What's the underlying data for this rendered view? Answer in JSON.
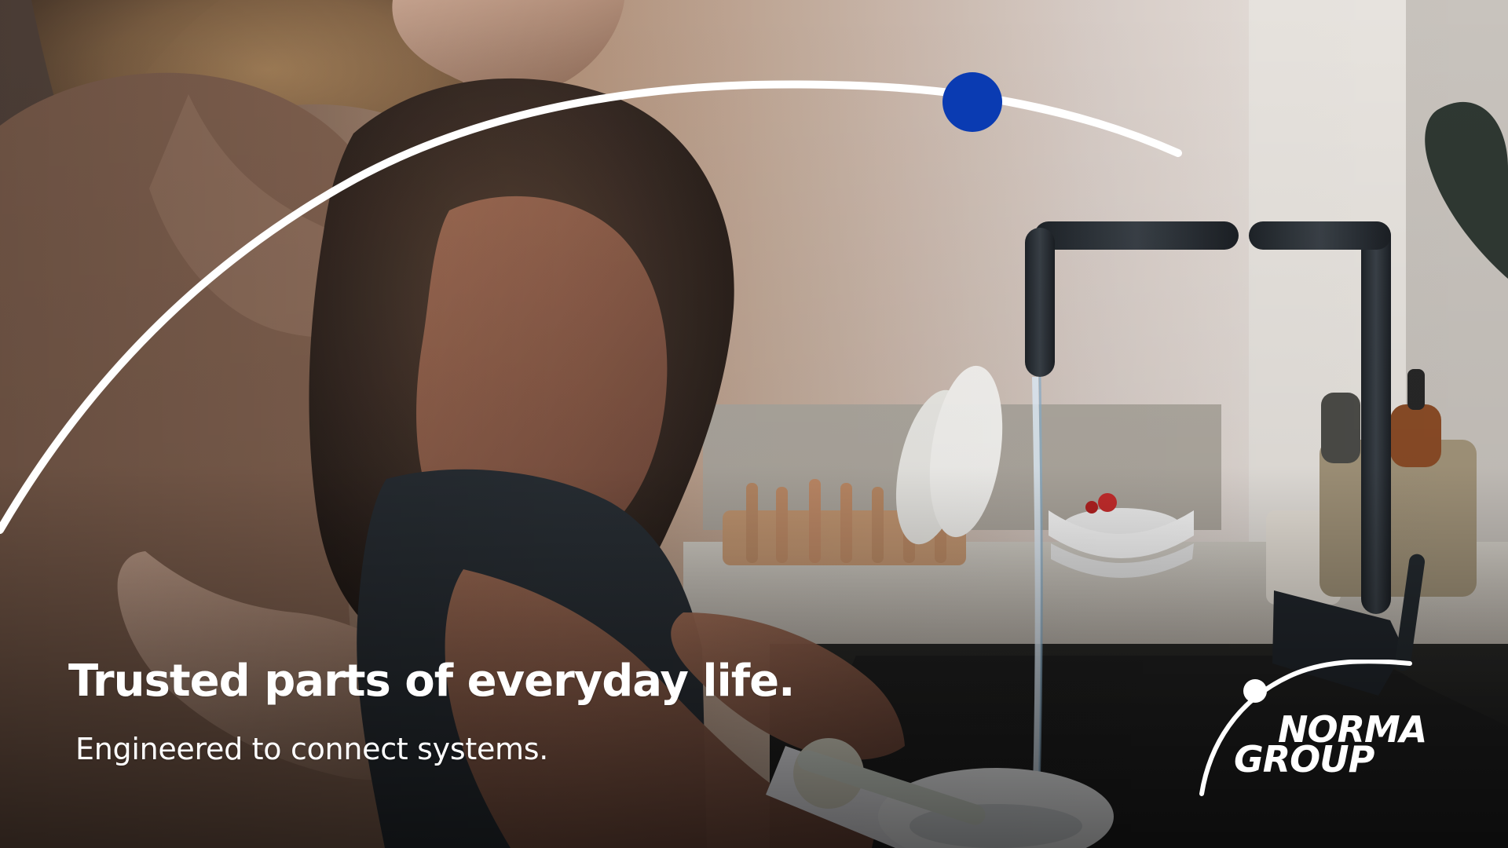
{
  "headline": "Trusted parts of everyday life.",
  "subheadline": "Engineered to connect systems.",
  "logo": {
    "line1": "NORMA",
    "line2": "GROUP"
  },
  "colors": {
    "text": "#ffffff",
    "brand_blue": "#0a3bb2",
    "arc": "#ffffff"
  }
}
